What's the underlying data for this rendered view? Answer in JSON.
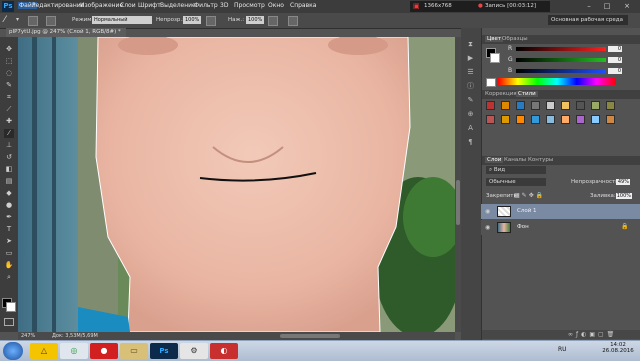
{
  "app": {
    "name": "Ps"
  },
  "menu": [
    "Файл",
    "Редактирование",
    "Изображение",
    "Слои",
    "Шрифт",
    "Выделение",
    "Фильтр",
    "3D",
    "Просмотр",
    "Окно",
    "Справка"
  ],
  "menu_selected": "Файл",
  "recorder": {
    "resolution": "1366x768",
    "recording": "Запись [00:03:12]"
  },
  "window_controls": {
    "minimize": "–",
    "maximize": "□",
    "close": "×"
  },
  "options_bar": {
    "mode_label": "Режим:",
    "mode_value": "Нормальный",
    "opacity_label": "Непрозр.:",
    "opacity_value": "100%",
    "pressure_label": "Наж.:",
    "pressure_value": "100%"
  },
  "workspace": "Основная рабочая среда",
  "document_tab": "pIP7ytU.jpg @ 247% (Слой 1, RGB/8#) *",
  "status": {
    "zoom": "247%",
    "doc_size": "Док: 3,53M/5,69M"
  },
  "color_panel": {
    "tabs": [
      "Цвет",
      "Образцы"
    ],
    "channels": [
      {
        "label": "R",
        "value": "0",
        "color": "#ff3030"
      },
      {
        "label": "G",
        "value": "0",
        "color": "#30c030"
      },
      {
        "label": "B",
        "value": "0",
        "color": "#3050ff"
      }
    ]
  },
  "adjustments_panel": {
    "tabs": [
      "Коррекция",
      "Стили"
    ],
    "style_swatches": [
      "#b33",
      "#d80",
      "#2a7ac0",
      "#777",
      "#ccc",
      "#f0c060",
      "#555",
      "#9a6",
      "#884",
      "#b55",
      "#d90",
      "#f80",
      "#39d",
      "#8bd",
      "#fa6",
      "#a6c",
      "#8cf",
      "#c84"
    ]
  },
  "layers_panel": {
    "tabs": [
      "Слои",
      "Каналы",
      "Контуры"
    ],
    "kind_label": "Вид",
    "blend_mode": "Обычные",
    "opacity_label": "Непрозрачность:",
    "opacity_value": "49%",
    "lock_label": "Закрепить:",
    "fill_label": "Заливка:",
    "fill_value": "100%",
    "layers": [
      {
        "name": "Слой 1",
        "selected": true
      },
      {
        "name": "Фон",
        "selected": false,
        "locked": true
      }
    ]
  },
  "taskbar": {
    "start_icon": "windows-start-icon",
    "apps": [
      "avast-icon",
      "chrome-icon",
      "recorder-icon",
      "explorer-icon",
      "photoshop-icon",
      "steam-icon",
      "red-app-icon"
    ],
    "language": "RU",
    "time": "14:02",
    "date": "26.08.2016"
  }
}
